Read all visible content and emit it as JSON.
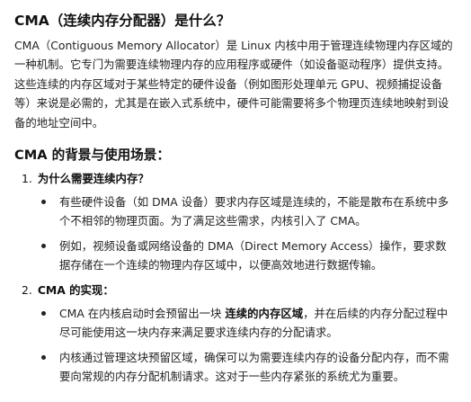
{
  "title": "CMA（连续内存分配器）是什么？",
  "intro": "CMA（Contiguous Memory Allocator）是 Linux 内核中用于管理连续物理内存区域的一种机制。它专门为需要连续物理内存的应用程序或硬件（如设备驱动程序）提供支持。这些连续的内存区域对于某些特定的硬件设备（例如图形处理单元 GPU、视频捕捉设备等）来说是必需的，尤其是在嵌入式系统中，硬件可能需要将多个物理页连续地映射到设备的地址空间中。",
  "section_heading": "CMA 的背景与使用场景：",
  "list": [
    {
      "number": "1.",
      "heading": "为什么需要连续内存？",
      "bullets": [
        "有些硬件设备（如 DMA 设备）要求内存区域是连续的，不能是散布在系统中多个不相邻的物理页面。为了满足这些需求，内核引入了 CMA。",
        "例如，视频设备或网络设备的 DMA（Direct Memory Access）操作，要求数据存储在一个连续的物理内存区域中，以便高效地进行数据传输。"
      ]
    },
    {
      "number": "2.",
      "heading": "CMA 的实现：",
      "bullets": [
        {
          "before": "CMA 在内核启动时会预留出一块 ",
          "bold": "连续的内存区域",
          "after": "，并在后续的内存分配过程中尽可能使用这一块内存来满足要求连续内存的分配请求。"
        },
        "内核通过管理这块预留区域，确保可以为需要连续内存的设备分配内存，而不需要向常规的内存分配机制请求。这对于一些内存紧张的系统尤为重要。"
      ]
    }
  ]
}
